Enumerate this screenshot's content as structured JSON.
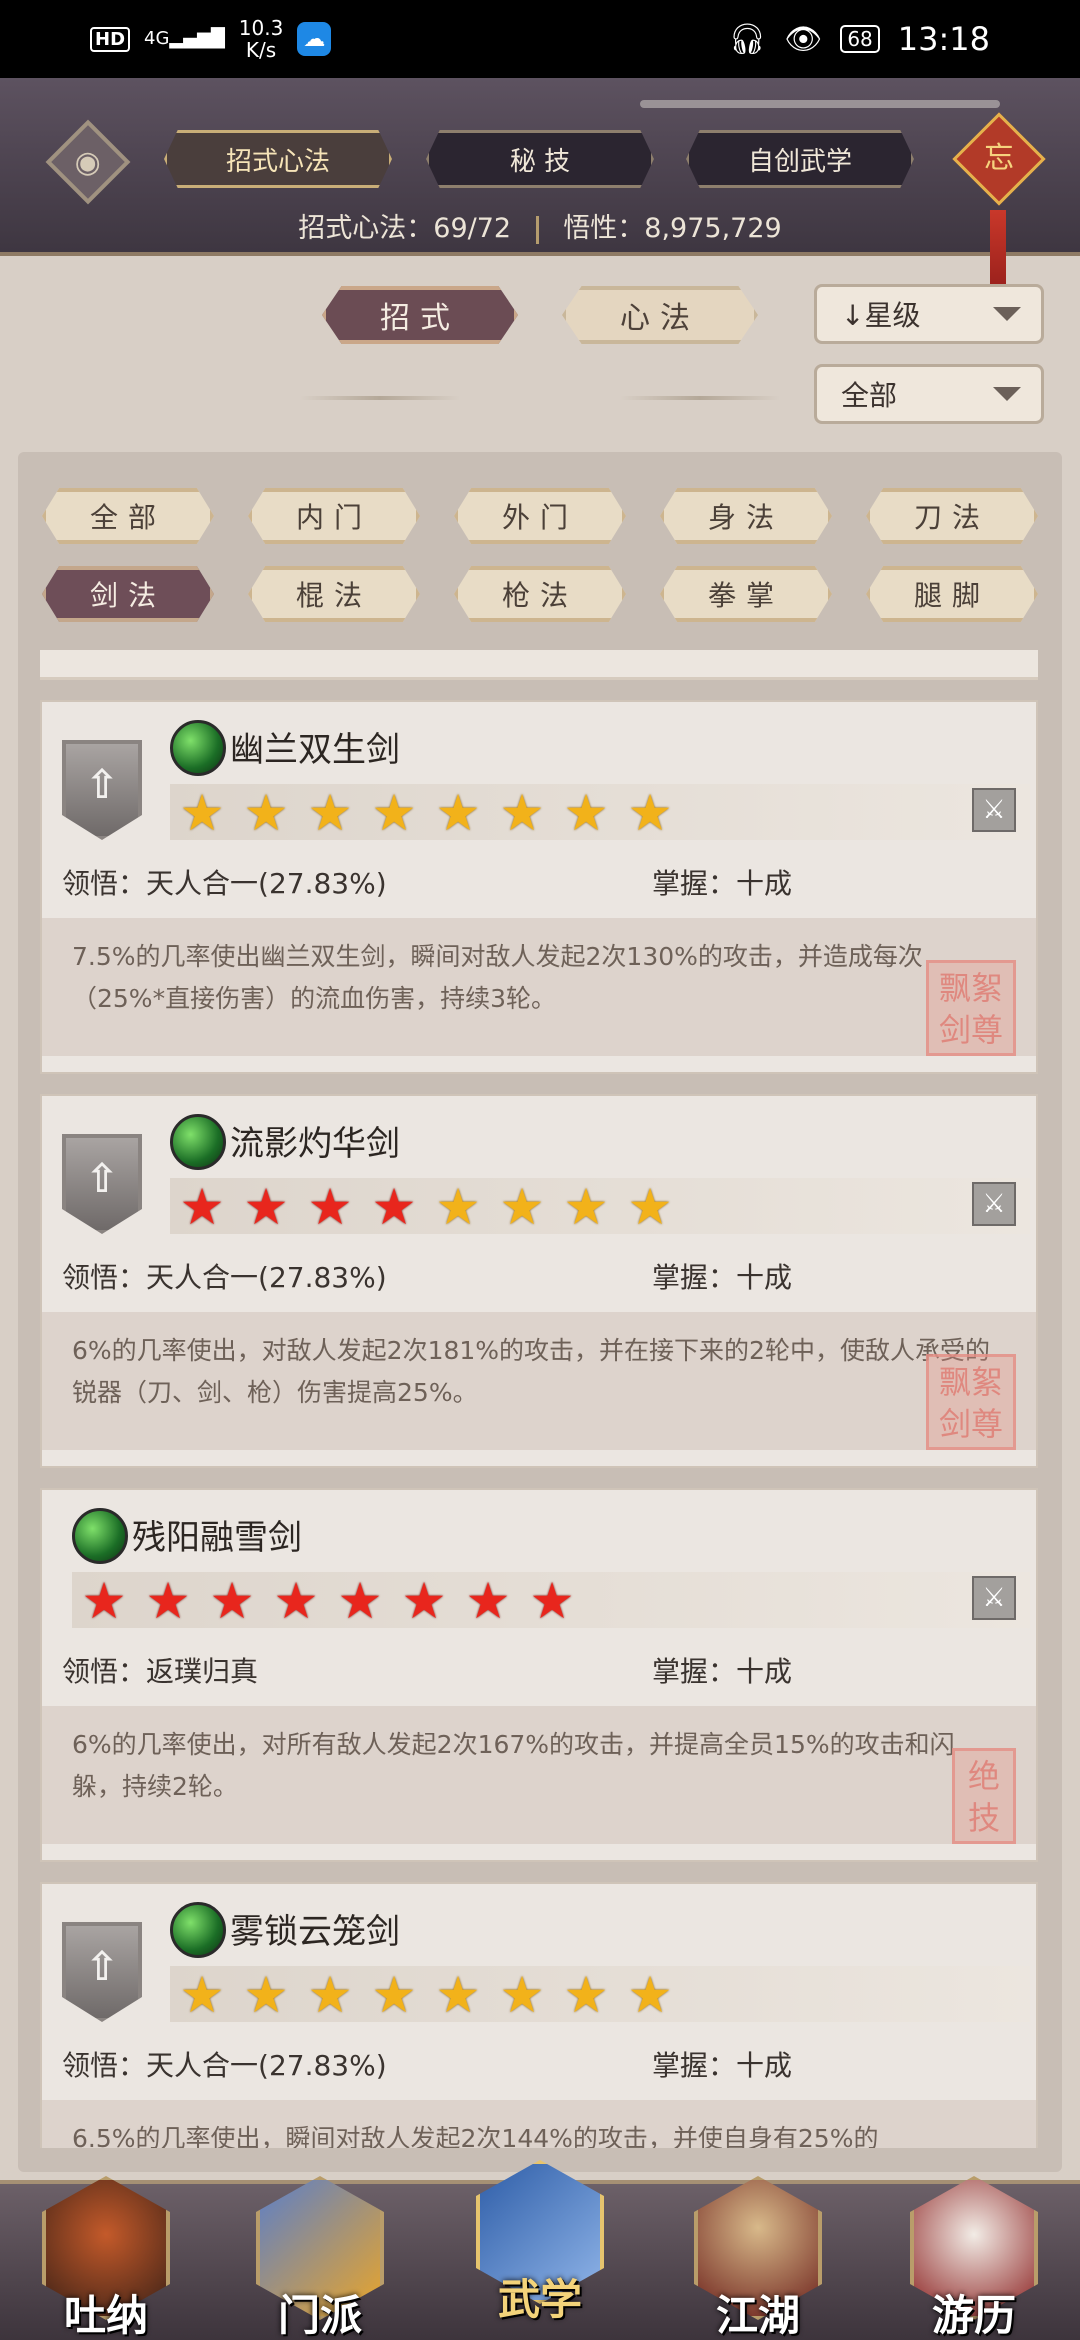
{
  "status_bar": {
    "hd": "HD",
    "signal": "4G",
    "speed_value": "10.3",
    "speed_unit": "K/s",
    "battery": "68",
    "time": "13:18"
  },
  "header": {
    "tabs": [
      {
        "label": "招式心法",
        "active": true
      },
      {
        "label": "秘 技",
        "active": false
      },
      {
        "label": "自创武学",
        "active": false
      }
    ],
    "knot_char": "忘",
    "stats": {
      "skills_label": "招式心法：",
      "skills_value": "69/72",
      "insight_label": "悟性：",
      "insight_value": "8,975,729"
    }
  },
  "filters": {
    "type_toggle": [
      {
        "label": "招式",
        "active": true
      },
      {
        "label": "心法",
        "active": false
      }
    ],
    "sort_dropdown": "↓星级",
    "scope_dropdown": "全部",
    "categories": [
      {
        "label": "全部",
        "active": false
      },
      {
        "label": "内门",
        "active": false
      },
      {
        "label": "外门",
        "active": false
      },
      {
        "label": "身法",
        "active": false
      },
      {
        "label": "刀法",
        "active": false
      },
      {
        "label": "剑法",
        "active": true
      },
      {
        "label": "棍法",
        "active": false
      },
      {
        "label": "枪法",
        "active": false
      },
      {
        "label": "拳掌",
        "active": false
      },
      {
        "label": "腿脚",
        "active": false
      }
    ]
  },
  "skills": [
    {
      "name": "幽兰双生剑",
      "has_upgrade": true,
      "stars": [
        "gold",
        "gold",
        "gold",
        "gold",
        "gold",
        "gold",
        "gold",
        "gold"
      ],
      "comprehension_label": "领悟：",
      "comprehension": "天人合一(27.83%)",
      "mastery_label": "掌握：",
      "mastery": "十成",
      "description": "7.5%的几率使出幽兰双生剑，瞬间对敌人发起2次130%的攻击，并造成每次（25%*直接伤害）的流血伤害，持续3轮。",
      "seal_text": "飘絮剑尊"
    },
    {
      "name": "流影灼华剑",
      "has_upgrade": true,
      "stars": [
        "red",
        "red",
        "red",
        "red",
        "gold",
        "gold",
        "gold",
        "gold"
      ],
      "comprehension_label": "领悟：",
      "comprehension": "天人合一(27.83%)",
      "mastery_label": "掌握：",
      "mastery": "十成",
      "description": "6%的几率使出，对敌人发起2次181%的攻击，并在接下来的2轮中，使敌人承受的锐器（刀、剑、枪）伤害提高25%。",
      "seal_text": "飘絮剑尊"
    },
    {
      "name": "残阳融雪剑",
      "has_upgrade": false,
      "stars": [
        "red",
        "red",
        "red",
        "red",
        "red",
        "red",
        "red",
        "red"
      ],
      "comprehension_label": "领悟：",
      "comprehension": "返璞归真",
      "mastery_label": "掌握：",
      "mastery": "十成",
      "description": "6%的几率使出，对所有敌人发起2次167%的攻击，并提高全员15%的攻击和闪躲，持续2轮。",
      "seal_text": "绝技"
    },
    {
      "name": "雾锁云笼剑",
      "has_upgrade": true,
      "stars": [
        "gold",
        "gold",
        "gold",
        "gold",
        "gold",
        "gold",
        "gold",
        "gold"
      ],
      "comprehension_label": "领悟：",
      "comprehension": "天人合一(27.83%)",
      "mastery_label": "掌握：",
      "mastery": "十成",
      "description": "6.5%的几率使出，瞬间对敌人发起2次144%的攻击，并使自身有25%的",
      "seal_text": ""
    }
  ],
  "bottom_nav": [
    {
      "label": "吐纳",
      "active": false
    },
    {
      "label": "门派",
      "active": false
    },
    {
      "label": "武学",
      "active": true
    },
    {
      "label": "江湖",
      "active": false
    },
    {
      "label": "游历",
      "active": false
    }
  ]
}
